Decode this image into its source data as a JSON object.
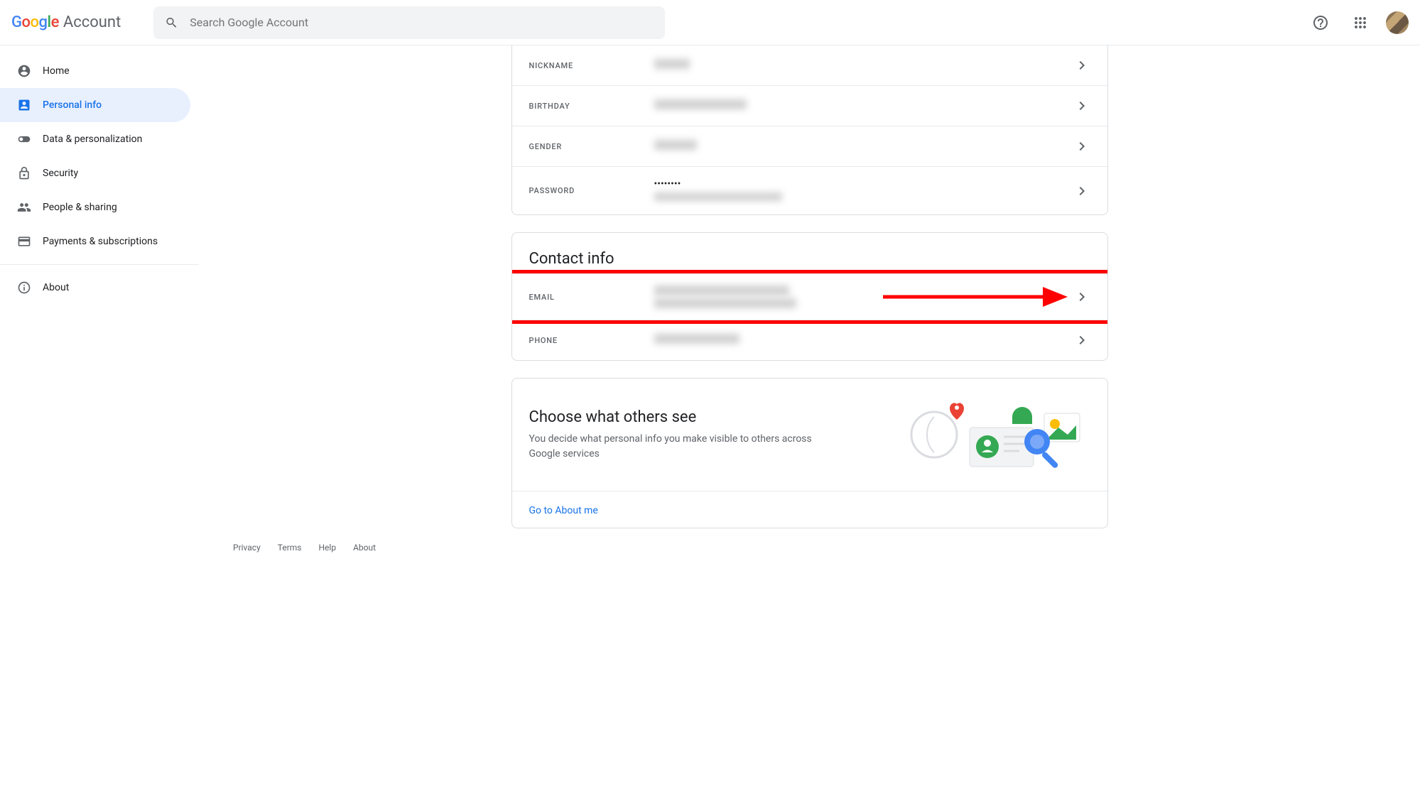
{
  "header": {
    "account_label": "Account",
    "search_placeholder": "Search Google Account"
  },
  "sidebar": {
    "items": [
      {
        "label": "Home"
      },
      {
        "label": "Personal info"
      },
      {
        "label": "Data & personalization"
      },
      {
        "label": "Security"
      },
      {
        "label": "People & sharing"
      },
      {
        "label": "Payments & subscriptions"
      },
      {
        "label": "About"
      }
    ]
  },
  "basic_info": {
    "nickname_label": "NICKNAME",
    "birthday_label": "BIRTHDAY",
    "gender_label": "GENDER",
    "password_label": "PASSWORD",
    "password_value": "••••••••"
  },
  "contact_info": {
    "title": "Contact info",
    "email_label": "EMAIL",
    "phone_label": "PHONE"
  },
  "choose": {
    "title": "Choose what others see",
    "description": "You decide what personal info you make visible to others across Google services",
    "link": "Go to About me"
  },
  "footer": {
    "privacy": "Privacy",
    "terms": "Terms",
    "help": "Help",
    "about": "About"
  }
}
